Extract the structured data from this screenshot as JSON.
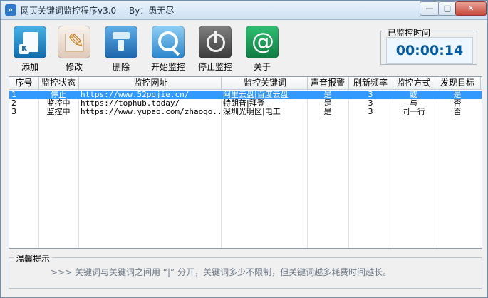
{
  "window": {
    "title": "网页关键词监控程序v3.0",
    "author": "By：愚无尽",
    "minimize": "—",
    "maximize": "□",
    "close": "✕"
  },
  "toolbar": [
    {
      "label": "添加",
      "icon": "add-document-icon"
    },
    {
      "label": "修改",
      "icon": "edit-pencil-icon"
    },
    {
      "label": "删除",
      "icon": "delete-icon"
    },
    {
      "label": "开始监控",
      "icon": "search-icon"
    },
    {
      "label": "停止监控",
      "icon": "power-icon"
    },
    {
      "label": "关于",
      "icon": "at-icon"
    }
  ],
  "timer": {
    "label": "已监控时间",
    "value": "00:00:14"
  },
  "table": {
    "columns": [
      "序号",
      "监控状态",
      "监控网址",
      "监控关键词",
      "声音报警",
      "刷新频率",
      "监控方式",
      "发现目标"
    ],
    "rows": [
      {
        "id": "1",
        "status": "停止",
        "url": "https://www.52pojie.cn/",
        "keyword": "阿里云盘|百度云盘",
        "sound": "是",
        "frequency": "3",
        "mode": "或",
        "found": "是",
        "selected": true
      },
      {
        "id": "2",
        "status": "监控中",
        "url": "https://tophub.today/",
        "keyword": "特朗普|拜登",
        "sound": "是",
        "frequency": "3",
        "mode": "与",
        "found": "否",
        "selected": false
      },
      {
        "id": "3",
        "status": "监控中",
        "url": "https://www.yupao.com/zhaogo...",
        "keyword": "深圳光明区|电工",
        "sound": "是",
        "frequency": "3",
        "mode": "同一行",
        "found": "否",
        "selected": false
      }
    ]
  },
  "tips": {
    "title": "温馨提示",
    "text": ">>> 关键词与关键词之间用 “|” 分开，关键词多少不限制，但关键词越多耗费时间越长。"
  },
  "colors": {
    "selection": "#3399ff",
    "timer": "#005c9f"
  }
}
